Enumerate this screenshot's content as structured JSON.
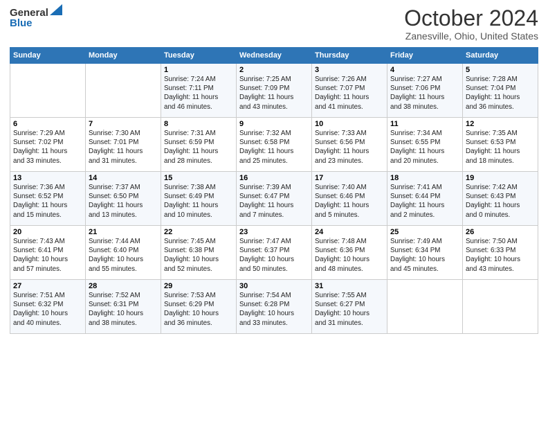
{
  "header": {
    "logo_line1": "General",
    "logo_line2": "Blue",
    "month_title": "October 2024",
    "location": "Zanesville, Ohio, United States"
  },
  "weekdays": [
    "Sunday",
    "Monday",
    "Tuesday",
    "Wednesday",
    "Thursday",
    "Friday",
    "Saturday"
  ],
  "weeks": [
    [
      {
        "day": "",
        "info": ""
      },
      {
        "day": "",
        "info": ""
      },
      {
        "day": "1",
        "info": "Sunrise: 7:24 AM\nSunset: 7:11 PM\nDaylight: 11 hours\nand 46 minutes."
      },
      {
        "day": "2",
        "info": "Sunrise: 7:25 AM\nSunset: 7:09 PM\nDaylight: 11 hours\nand 43 minutes."
      },
      {
        "day": "3",
        "info": "Sunrise: 7:26 AM\nSunset: 7:07 PM\nDaylight: 11 hours\nand 41 minutes."
      },
      {
        "day": "4",
        "info": "Sunrise: 7:27 AM\nSunset: 7:06 PM\nDaylight: 11 hours\nand 38 minutes."
      },
      {
        "day": "5",
        "info": "Sunrise: 7:28 AM\nSunset: 7:04 PM\nDaylight: 11 hours\nand 36 minutes."
      }
    ],
    [
      {
        "day": "6",
        "info": "Sunrise: 7:29 AM\nSunset: 7:02 PM\nDaylight: 11 hours\nand 33 minutes."
      },
      {
        "day": "7",
        "info": "Sunrise: 7:30 AM\nSunset: 7:01 PM\nDaylight: 11 hours\nand 31 minutes."
      },
      {
        "day": "8",
        "info": "Sunrise: 7:31 AM\nSunset: 6:59 PM\nDaylight: 11 hours\nand 28 minutes."
      },
      {
        "day": "9",
        "info": "Sunrise: 7:32 AM\nSunset: 6:58 PM\nDaylight: 11 hours\nand 25 minutes."
      },
      {
        "day": "10",
        "info": "Sunrise: 7:33 AM\nSunset: 6:56 PM\nDaylight: 11 hours\nand 23 minutes."
      },
      {
        "day": "11",
        "info": "Sunrise: 7:34 AM\nSunset: 6:55 PM\nDaylight: 11 hours\nand 20 minutes."
      },
      {
        "day": "12",
        "info": "Sunrise: 7:35 AM\nSunset: 6:53 PM\nDaylight: 11 hours\nand 18 minutes."
      }
    ],
    [
      {
        "day": "13",
        "info": "Sunrise: 7:36 AM\nSunset: 6:52 PM\nDaylight: 11 hours\nand 15 minutes."
      },
      {
        "day": "14",
        "info": "Sunrise: 7:37 AM\nSunset: 6:50 PM\nDaylight: 11 hours\nand 13 minutes."
      },
      {
        "day": "15",
        "info": "Sunrise: 7:38 AM\nSunset: 6:49 PM\nDaylight: 11 hours\nand 10 minutes."
      },
      {
        "day": "16",
        "info": "Sunrise: 7:39 AM\nSunset: 6:47 PM\nDaylight: 11 hours\nand 7 minutes."
      },
      {
        "day": "17",
        "info": "Sunrise: 7:40 AM\nSunset: 6:46 PM\nDaylight: 11 hours\nand 5 minutes."
      },
      {
        "day": "18",
        "info": "Sunrise: 7:41 AM\nSunset: 6:44 PM\nDaylight: 11 hours\nand 2 minutes."
      },
      {
        "day": "19",
        "info": "Sunrise: 7:42 AM\nSunset: 6:43 PM\nDaylight: 11 hours\nand 0 minutes."
      }
    ],
    [
      {
        "day": "20",
        "info": "Sunrise: 7:43 AM\nSunset: 6:41 PM\nDaylight: 10 hours\nand 57 minutes."
      },
      {
        "day": "21",
        "info": "Sunrise: 7:44 AM\nSunset: 6:40 PM\nDaylight: 10 hours\nand 55 minutes."
      },
      {
        "day": "22",
        "info": "Sunrise: 7:45 AM\nSunset: 6:38 PM\nDaylight: 10 hours\nand 52 minutes."
      },
      {
        "day": "23",
        "info": "Sunrise: 7:47 AM\nSunset: 6:37 PM\nDaylight: 10 hours\nand 50 minutes."
      },
      {
        "day": "24",
        "info": "Sunrise: 7:48 AM\nSunset: 6:36 PM\nDaylight: 10 hours\nand 48 minutes."
      },
      {
        "day": "25",
        "info": "Sunrise: 7:49 AM\nSunset: 6:34 PM\nDaylight: 10 hours\nand 45 minutes."
      },
      {
        "day": "26",
        "info": "Sunrise: 7:50 AM\nSunset: 6:33 PM\nDaylight: 10 hours\nand 43 minutes."
      }
    ],
    [
      {
        "day": "27",
        "info": "Sunrise: 7:51 AM\nSunset: 6:32 PM\nDaylight: 10 hours\nand 40 minutes."
      },
      {
        "day": "28",
        "info": "Sunrise: 7:52 AM\nSunset: 6:31 PM\nDaylight: 10 hours\nand 38 minutes."
      },
      {
        "day": "29",
        "info": "Sunrise: 7:53 AM\nSunset: 6:29 PM\nDaylight: 10 hours\nand 36 minutes."
      },
      {
        "day": "30",
        "info": "Sunrise: 7:54 AM\nSunset: 6:28 PM\nDaylight: 10 hours\nand 33 minutes."
      },
      {
        "day": "31",
        "info": "Sunrise: 7:55 AM\nSunset: 6:27 PM\nDaylight: 10 hours\nand 31 minutes."
      },
      {
        "day": "",
        "info": ""
      },
      {
        "day": "",
        "info": ""
      }
    ]
  ]
}
